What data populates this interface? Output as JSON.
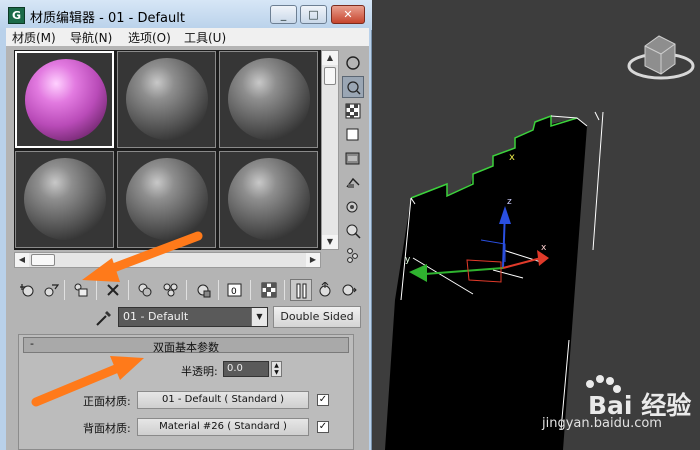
{
  "window": {
    "title": "材质编辑器 - 01 - Default",
    "app_icon_label": "G",
    "buttons": {
      "minimize": "_",
      "maximize": "□",
      "close": "✕"
    }
  },
  "menu": {
    "items": [
      "材质(M)",
      "导航(N)",
      "选项(O)",
      "工具(U)"
    ]
  },
  "sample_slots": {
    "count": 6,
    "active_index": 0,
    "active_color": "#e27ae0"
  },
  "side_toolbar_icons": [
    "sample-type-sphere-icon",
    "backlight-icon",
    "background-checker-icon",
    "sample-uv-tiling-icon",
    "video-color-check-icon",
    "make-preview-icon",
    "options-icon",
    "select-by-material-icon",
    "material-map-navigator-icon"
  ],
  "bottom_toolbar_icons": [
    "get-material-icon",
    "put-to-scene-icon",
    "assign-to-selection-icon",
    "reset-map-icon",
    "make-copy-icon",
    "make-unique-icon",
    "put-to-library-icon",
    "material-id-channel-icon",
    "show-shaded-icon",
    "show-end-result-icon",
    "go-to-parent-icon",
    "go-forward-to-sibling-icon"
  ],
  "name_row": {
    "material_name": "01 - Default",
    "type_button": "Double Sided"
  },
  "rollout": {
    "minus": "-",
    "title": "双面基本参数",
    "translucency_label": "半透明:",
    "translucency_value": "0.0",
    "facing_label": "正面材质:",
    "facing_material": "01 - Default  ( Standard )",
    "facing_checked": "✓",
    "back_label": "背面材质:",
    "back_material": "Material #26  ( Standard )",
    "back_checked": "✓"
  },
  "viewport": {
    "gizmo_axes": {
      "x": "x",
      "y": "y",
      "z": "z"
    }
  },
  "watermark": {
    "brand": "Bai 经验",
    "url": "jingyan.baidu.com"
  }
}
